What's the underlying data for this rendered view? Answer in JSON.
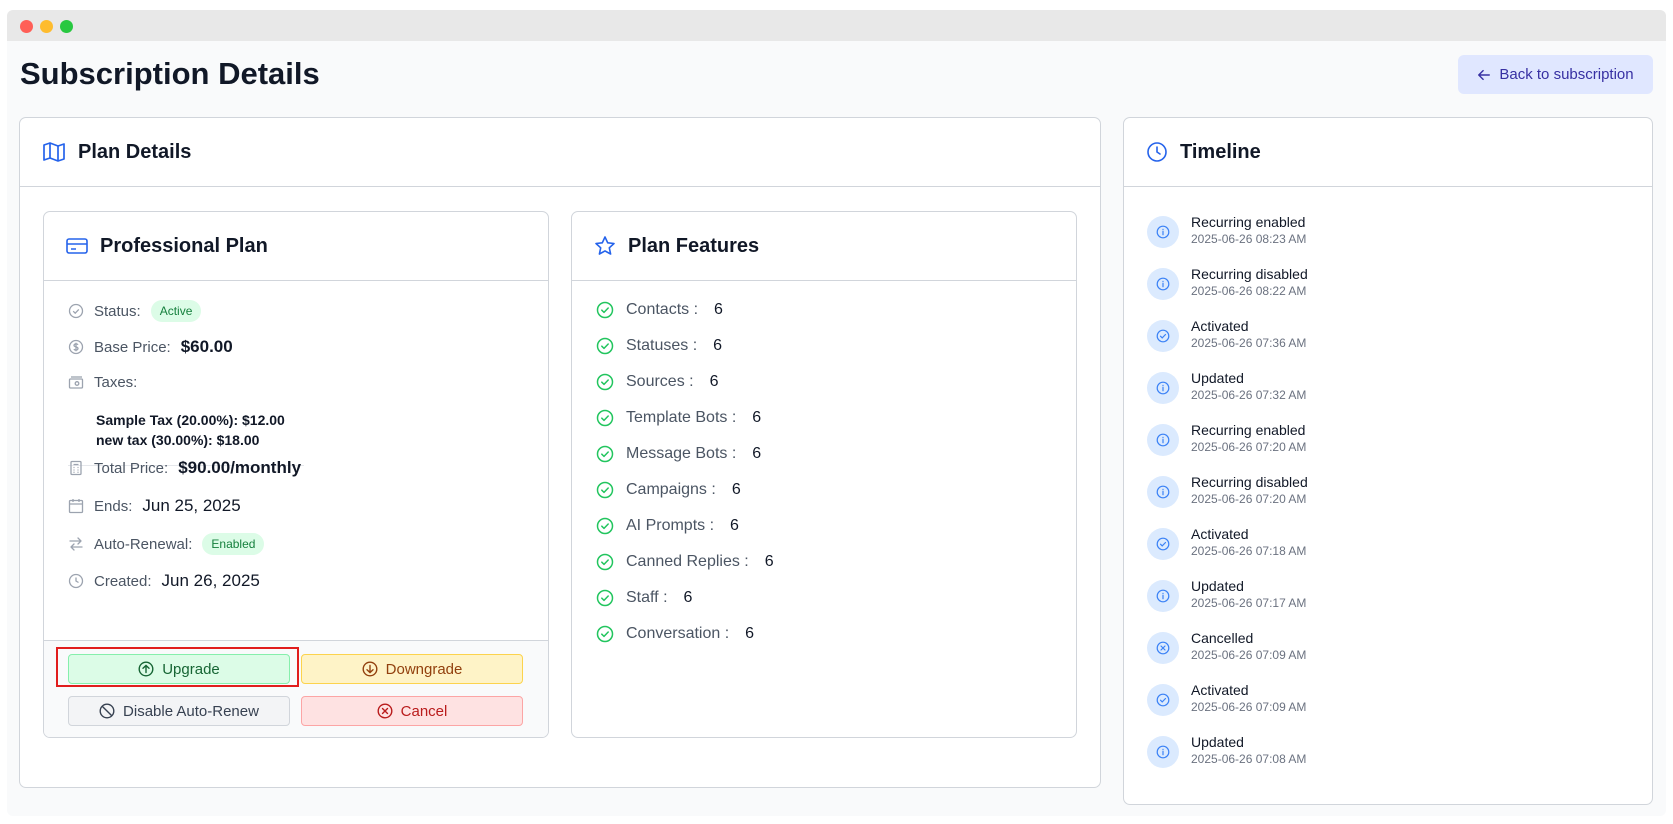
{
  "page": {
    "title": "Subscription Details",
    "back_label": "Back to subscription"
  },
  "plan_details": {
    "header": "Plan Details",
    "plan": {
      "name": "Professional Plan",
      "status_label": "Status:",
      "status_value": "Active",
      "base_price_label": "Base Price:",
      "base_price_value": "$60.00",
      "taxes_label": "Taxes:",
      "taxes": [
        "Sample Tax (20.00%): $12.00",
        "new tax (30.00%): $18.00"
      ],
      "total_label": "Total Price:",
      "total_value": "$90.00/monthly",
      "ends_label": "Ends:",
      "ends_value": "Jun 25, 2025",
      "renewal_label": "Auto-Renewal:",
      "renewal_value": "Enabled",
      "created_label": "Created:",
      "created_value": "Jun 26, 2025"
    },
    "actions": {
      "upgrade": "Upgrade",
      "downgrade": "Downgrade",
      "disable": "Disable Auto-Renew",
      "cancel": "Cancel"
    },
    "features": {
      "header": "Plan Features",
      "items": [
        {
          "label": "Contacts :",
          "value": "6"
        },
        {
          "label": "Statuses :",
          "value": "6"
        },
        {
          "label": "Sources :",
          "value": "6"
        },
        {
          "label": "Template Bots :",
          "value": "6"
        },
        {
          "label": "Message Bots :",
          "value": "6"
        },
        {
          "label": "Campaigns :",
          "value": "6"
        },
        {
          "label": "AI Prompts :",
          "value": "6"
        },
        {
          "label": "Canned Replies :",
          "value": "6"
        },
        {
          "label": "Staff :",
          "value": "6"
        },
        {
          "label": "Conversation :",
          "value": "6"
        }
      ]
    }
  },
  "timeline": {
    "header": "Timeline",
    "items": [
      {
        "title": "Recurring enabled",
        "date": "2025-06-26 08:23 AM",
        "icon": "info-icon"
      },
      {
        "title": "Recurring disabled",
        "date": "2025-06-26 08:22 AM",
        "icon": "info-icon"
      },
      {
        "title": "Activated",
        "date": "2025-06-26 07:36 AM",
        "icon": "check-circle-icon"
      },
      {
        "title": "Updated",
        "date": "2025-06-26 07:32 AM",
        "icon": "info-icon"
      },
      {
        "title": "Recurring enabled",
        "date": "2025-06-26 07:20 AM",
        "icon": "info-icon"
      },
      {
        "title": "Recurring disabled",
        "date": "2025-06-26 07:20 AM",
        "icon": "info-icon"
      },
      {
        "title": "Activated",
        "date": "2025-06-26 07:18 AM",
        "icon": "check-circle-icon"
      },
      {
        "title": "Updated",
        "date": "2025-06-26 07:17 AM",
        "icon": "info-icon"
      },
      {
        "title": "Cancelled",
        "date": "2025-06-26 07:09 AM",
        "icon": "x-circle-icon"
      },
      {
        "title": "Activated",
        "date": "2025-06-26 07:09 AM",
        "icon": "check-circle-icon"
      },
      {
        "title": "Updated",
        "date": "2025-06-26 07:08 AM",
        "icon": "info-icon"
      }
    ]
  }
}
